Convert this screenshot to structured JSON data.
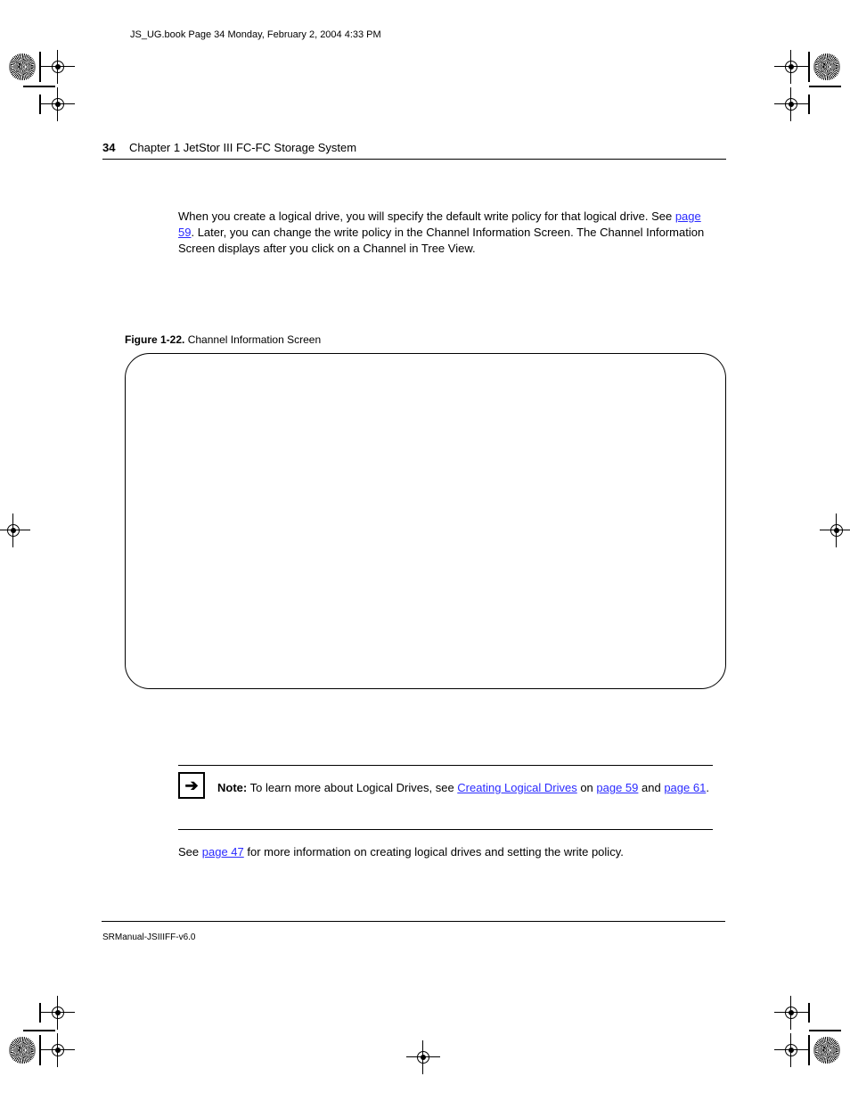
{
  "pdf_stamp": "JS_UG.book  Page 34  Monday, February 2, 2004  4:33 PM",
  "page_number": "34",
  "chapter_head": "Chapter 1  JetStor III FC-FC Storage System",
  "intro": {
    "text_before_link": "When you create a logical drive, you will specify the default write policy for that logical drive. See ",
    "link_text": "page 59",
    "text_after_link": ". Later, you can change the write policy in the Channel Information Screen. The Channel Information Screen displays after you click on a Channel in Tree View."
  },
  "figure": {
    "label_bold": "Figure 1-22.",
    "label_text": "Channel Information Screen"
  },
  "note": {
    "prefix": "Note:",
    "before_link": "To learn more about Logical Drives, see ",
    "link1": "Creating Logical Drives",
    "between": " on ",
    "link2": "page 59",
    "suffix_text": " and ",
    "link3": "page 61",
    "period": "."
  },
  "post_note": {
    "before": "See ",
    "link": "page 47",
    "after": " for more information on creating logical drives and setting the write policy."
  },
  "doc_footer": "SRManual-JSIIIFF-v6.0"
}
